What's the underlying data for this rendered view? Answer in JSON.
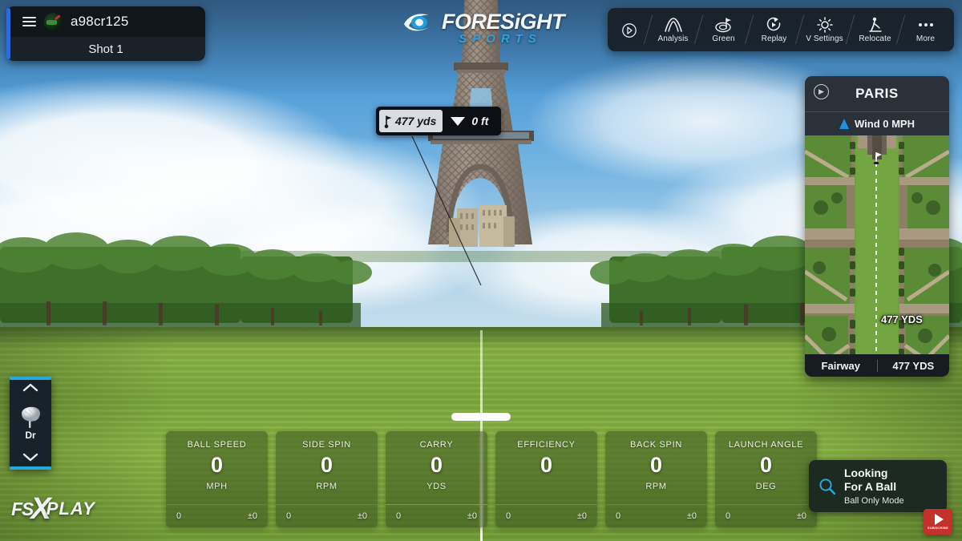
{
  "player": {
    "menu_icon": "hamburger-icon",
    "avatar_icon": "player-avatar",
    "name": "a98cr125",
    "shot_label": "Shot 1"
  },
  "brand": {
    "logo_icon": "foresight-eye-icon",
    "name": "FORESiGHT",
    "tagline": "SPORTS"
  },
  "toolbar": {
    "items": [
      {
        "icon": "expand-circle-icon",
        "label": ""
      },
      {
        "icon": "analysis-arc-icon",
        "label": "Analysis"
      },
      {
        "icon": "green-flag-icon",
        "label": "Green"
      },
      {
        "icon": "replay-icon",
        "label": "Replay"
      },
      {
        "icon": "sun-settings-icon",
        "label": "V Settings"
      },
      {
        "icon": "relocate-golfer-icon",
        "label": "Relocate"
      },
      {
        "icon": "more-dots-icon",
        "label": "More"
      }
    ]
  },
  "distance_marker": {
    "flag_icon": "pin-flag-icon",
    "distance": "477 yds",
    "elevation_icon": "triangle-down-icon",
    "elevation": "0 ft"
  },
  "club_selector": {
    "up_icon": "chevron-up-icon",
    "club_icon": "driver-head-icon",
    "club": "Dr",
    "down_icon": "chevron-down-icon"
  },
  "minimap": {
    "expand_icon": "expand-circle-icon",
    "title": "PARIS",
    "wind_icon": "wind-arrow-icon",
    "wind": "Wind 0 MPH",
    "flag_icon": "pin-flag-icon",
    "ball_icon": "ball-position-icon",
    "distance_overlay": "477 YDS",
    "lie": "Fairway",
    "hole_distance": "477 YDS"
  },
  "stats": [
    {
      "label": "BALL SPEED",
      "value": "0",
      "unit": "MPH",
      "foot_left": "0",
      "foot_right": "±0",
      "accent": "#3f8f7a"
    },
    {
      "label": "SIDE SPIN",
      "value": "0",
      "unit": "RPM",
      "foot_left": "0",
      "foot_right": "±0",
      "accent": "#3f8f7a"
    },
    {
      "label": "CARRY",
      "value": "0",
      "unit": "YDS",
      "foot_left": "0",
      "foot_right": "±0",
      "accent": "#8c9648"
    },
    {
      "label": "EFFICIENCY",
      "value": "0",
      "unit": "",
      "foot_left": "0",
      "foot_right": "±0",
      "accent": "#6f8a52"
    },
    {
      "label": "BACK SPIN",
      "value": "0",
      "unit": "RPM",
      "foot_left": "0",
      "foot_right": "±0",
      "accent": "#3f8f7a"
    },
    {
      "label": "LAUNCH ANGLE",
      "value": "0",
      "unit": "DEG",
      "foot_left": "0",
      "foot_right": "±0",
      "accent": "#3f8f7a"
    }
  ],
  "ball_status": {
    "search_icon": "magnifier-icon",
    "line1": "Looking",
    "line2": "For A Ball",
    "line3": "Ball Only  Mode"
  },
  "watermark": {
    "fsx_left": "FS",
    "fsx_x": "X",
    "fsx_right": "PLAY",
    "youtube_icon": "youtube-play-icon",
    "youtube_label": "SUBSCRIBE"
  },
  "colors": {
    "accent_blue": "#27a9df",
    "player_accent": "#2f6bdd",
    "panel_dark": "#161c22",
    "wind_blue": "#1e90e8"
  }
}
